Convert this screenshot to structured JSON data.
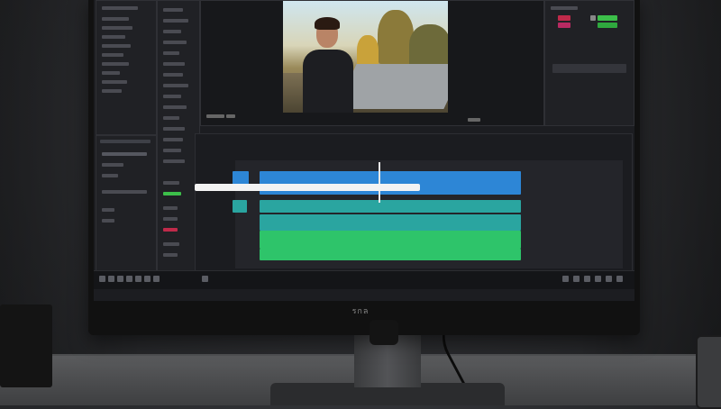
{
  "scene": {
    "description_colors": {
      "clip_blue": "#2d86d6",
      "clip_teal": "#2aa5a0",
      "clip_green": "#2ec46a",
      "accent_red": "#c02a4a",
      "accent_green": "#3cbf4a"
    }
  },
  "monitor": {
    "brand_text": "รกล"
  },
  "editor": {
    "left_panel_items": 22,
    "timeline_tracks": 4
  }
}
